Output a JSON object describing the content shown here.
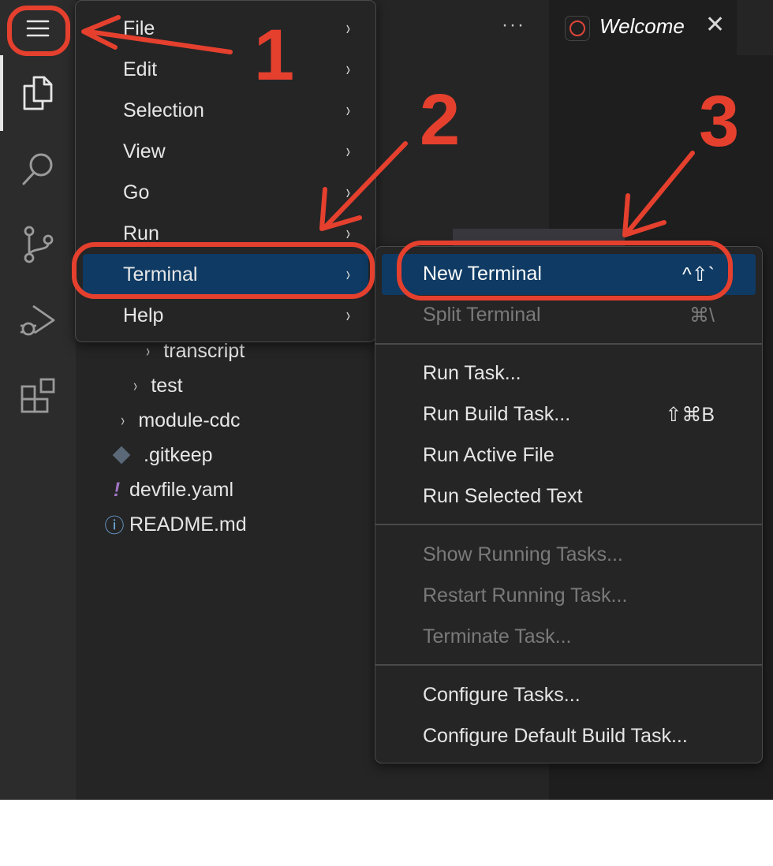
{
  "tab": {
    "label": "Welcome",
    "close": "✕"
  },
  "more_actions": "···",
  "main_menu": [
    {
      "label": "File",
      "arrow": "›"
    },
    {
      "label": "Edit",
      "arrow": "›"
    },
    {
      "label": "Selection",
      "arrow": "›"
    },
    {
      "label": "View",
      "arrow": "›"
    },
    {
      "label": "Go",
      "arrow": "›"
    },
    {
      "label": "Run",
      "arrow": "›"
    },
    {
      "label": "Terminal",
      "arrow": "›",
      "highlighted": true
    },
    {
      "label": "Help",
      "arrow": "›"
    }
  ],
  "terminal_menu": [
    {
      "label": "New Terminal",
      "shortcut": "^⇧`",
      "highlighted": true
    },
    {
      "label": "Split Terminal",
      "shortcut": "⌘\\",
      "disabled": true
    },
    {
      "label": "Run Task..."
    },
    {
      "label": "Run Build Task...",
      "shortcut": "⇧⌘B"
    },
    {
      "label": "Run Active File"
    },
    {
      "label": "Run Selected Text"
    },
    {
      "label": "Show Running Tasks...",
      "disabled": true
    },
    {
      "label": "Restart Running Task...",
      "disabled": true
    },
    {
      "label": "Terminate Task...",
      "disabled": true
    },
    {
      "label": "Configure Tasks..."
    },
    {
      "label": "Configure Default Build Task..."
    }
  ],
  "explorer": [
    {
      "label": "transcript",
      "chevron": "›"
    },
    {
      "label": "test",
      "chevron": "›"
    },
    {
      "label": "module-cdc",
      "chevron": "›"
    },
    {
      "label": ".gitkeep",
      "icon": "git-icon"
    },
    {
      "label": "devfile.yaml",
      "icon": "yaml-icon",
      "glyph": "!"
    },
    {
      "label": "README.md",
      "icon": "info-icon",
      "glyph": "ⓘ"
    }
  ],
  "activity_bar": [
    "menu-icon",
    "explorer-icon",
    "search-icon",
    "source-control-icon",
    "run-debug-icon",
    "extensions-icon"
  ],
  "annotations": [
    "1",
    "2",
    "3"
  ],
  "colors": {
    "accent": "#0e3a63",
    "annotation": "#e5402e",
    "background": "#1e1e1e",
    "sidebar": "#252526"
  }
}
